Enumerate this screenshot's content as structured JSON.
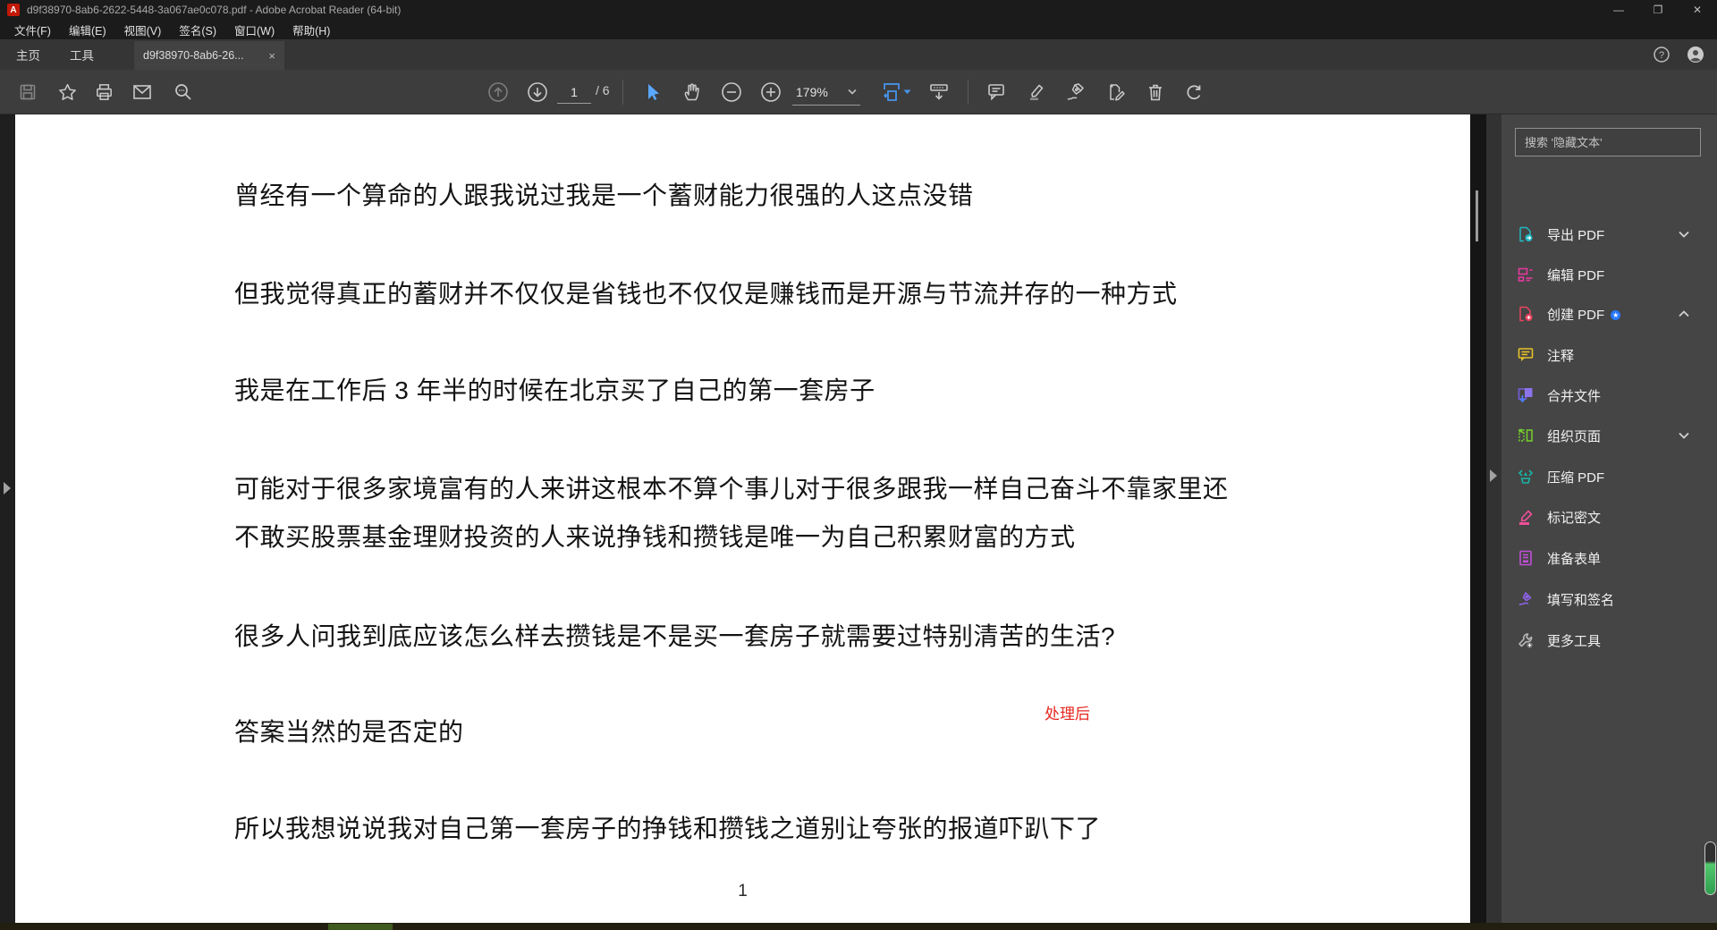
{
  "window": {
    "title": "d9f38970-8ab6-2622-5448-3a067ae0c078.pdf - Adobe Acrobat Reader (64-bit)",
    "controls": {
      "minimize": "—",
      "restore": "❐",
      "close": "✕"
    }
  },
  "menu": {
    "items": [
      "文件(F)",
      "编辑(E)",
      "视图(V)",
      "签名(S)",
      "窗口(W)",
      "帮助(H)"
    ]
  },
  "tabs": {
    "home": "主页",
    "tools": "工具",
    "document": "d9f38970-8ab6-26...",
    "close": "×"
  },
  "toolbar": {
    "page_current": "1",
    "page_total": "/ 6",
    "zoom_level": "179%",
    "accent_blue": "#5aa7ff"
  },
  "sidebar": {
    "search_placeholder": "搜索 '隐藏文本'",
    "items": [
      {
        "label": "导出 PDF",
        "color": "#22b8c2",
        "chevron": "down"
      },
      {
        "label": "编辑 PDF",
        "color": "#e5399e",
        "chevron": "none"
      },
      {
        "label": "创建 PDF",
        "color": "#e8435e",
        "chevron": "up",
        "badge": "●"
      },
      {
        "label": "注释",
        "color": "#e6c229",
        "chevron": "none"
      },
      {
        "label": "合并文件",
        "color": "#7a5fe0",
        "chevron": "none"
      },
      {
        "label": "组织页面",
        "color": "#76d12d",
        "chevron": "down"
      },
      {
        "label": "压缩 PDF",
        "color": "#19b5a5",
        "chevron": "none"
      },
      {
        "label": "标记密文",
        "color": "#f0509a",
        "chevron": "none"
      },
      {
        "label": "准备表单",
        "color": "#c24fd8",
        "chevron": "none"
      },
      {
        "label": "填写和签名",
        "color": "#8e63e8",
        "chevron": "none"
      },
      {
        "label": "更多工具",
        "color": "#b5b5b5",
        "chevron": "none"
      }
    ]
  },
  "document": {
    "lines": [
      "曾经有一个算命的人跟我说过我是一个蓄财能力很强的人这点没错",
      "但我觉得真正的蓄财并不仅仅是省钱也不仅仅是赚钱而是开源与节流并存的一种方式",
      "我是在工作后 3 年半的时候在北京买了自己的第一套房子",
      "可能对于很多家境富有的人来讲这根本不算个事儿对于很多跟我一样自己奋斗不靠家里还",
      "不敢买股票基金理财投资的人来说挣钱和攒钱是唯一为自己积累财富的方式",
      "很多人问我到底应该怎么样去攒钱是不是买一套房子就需要过特别清苦的生活?",
      "答案当然的是否定的",
      "所以我想说说我对自己第一套房子的挣钱和攒钱之道别让夸张的报道吓趴下了"
    ],
    "annotation": "处理后",
    "annotation_color": "#e5261f",
    "page_number": "1"
  }
}
